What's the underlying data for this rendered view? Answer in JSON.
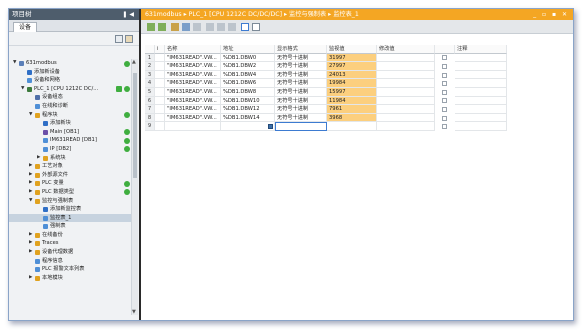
{
  "project_pane": {
    "title": "项目树",
    "controls": "❚◀",
    "tab": "设备",
    "tree": [
      {
        "label": "631modbus",
        "depth": 0,
        "expand": "▼",
        "icon": "#5a7fb8",
        "status": "ok"
      },
      {
        "label": "添加新设备",
        "depth": 1,
        "expand": "",
        "icon": "#2f6fc6"
      },
      {
        "label": "设备和网络",
        "depth": 1,
        "expand": "",
        "icon": "#4f8fd6"
      },
      {
        "label": "PLC_1 [CPU 1212C DC/...",
        "depth": 1,
        "expand": "▼",
        "icon": "#3c7a3c",
        "status": "ok2"
      },
      {
        "label": "设备组态",
        "depth": 2,
        "expand": "",
        "icon": "#4f6fa8"
      },
      {
        "label": "在线和诊断",
        "depth": 2,
        "expand": "",
        "icon": "#4f8fd6"
      },
      {
        "label": "程序块",
        "depth": 2,
        "expand": "▼",
        "icon": "#e0a21f",
        "status": "ok"
      },
      {
        "label": "添加新块",
        "depth": 3,
        "expand": "",
        "icon": "#2f6fc6"
      },
      {
        "label": "Main [OB1]",
        "depth": 3,
        "expand": "",
        "icon": "#6a4fa8",
        "status": "ok"
      },
      {
        "label": "IM631READ [DB1]",
        "depth": 3,
        "expand": "",
        "icon": "#4f8fd6",
        "status": "ok"
      },
      {
        "label": "IP [DB2]",
        "depth": 3,
        "expand": "",
        "icon": "#4f8fd6",
        "status": "ok"
      },
      {
        "label": "系统块",
        "depth": 3,
        "expand": "▶",
        "icon": "#e0a21f"
      },
      {
        "label": "工艺对象",
        "depth": 2,
        "expand": "▶",
        "icon": "#e0a21f"
      },
      {
        "label": "外部源文件",
        "depth": 2,
        "expand": "▶",
        "icon": "#e0a21f"
      },
      {
        "label": "PLC 变量",
        "depth": 2,
        "expand": "▶",
        "icon": "#e0a21f",
        "status": "ok"
      },
      {
        "label": "PLC 数据类型",
        "depth": 2,
        "expand": "▶",
        "icon": "#e0a21f",
        "status": "ok"
      },
      {
        "label": "监控与强制表",
        "depth": 2,
        "expand": "▼",
        "icon": "#e0a21f"
      },
      {
        "label": "添加新监控表",
        "depth": 3,
        "expand": "",
        "icon": "#2f6fc6"
      },
      {
        "label": "监控表_1",
        "depth": 3,
        "expand": "",
        "icon": "#4f8fd6",
        "selected": true
      },
      {
        "label": "强制表",
        "depth": 3,
        "expand": "",
        "icon": "#4f8fd6"
      },
      {
        "label": "在线备份",
        "depth": 2,
        "expand": "▶",
        "icon": "#e0a21f"
      },
      {
        "label": "Traces",
        "depth": 2,
        "expand": "▶",
        "icon": "#e0a21f"
      },
      {
        "label": "设备代理数据",
        "depth": 2,
        "expand": "▶",
        "icon": "#e0a21f"
      },
      {
        "label": "程序信息",
        "depth": 2,
        "expand": "",
        "icon": "#4f8fd6"
      },
      {
        "label": "PLC 报警文本列表",
        "depth": 2,
        "expand": "",
        "icon": "#4f8fd6"
      },
      {
        "label": "本地模块",
        "depth": 2,
        "expand": "▶",
        "icon": "#e0a21f"
      }
    ]
  },
  "editor": {
    "breadcrumb": "631modbus ▸ PLC_1 [CPU 1212C DC/DC/DC] ▸ 监控与强制表 ▸ 监控表_1",
    "controls": "_ ▫ ▪ ✕",
    "columns": [
      "i",
      "名称",
      "地址",
      "显示格式",
      "监视值",
      "修改值",
      "",
      "注释"
    ],
    "rows": [
      {
        "n": "1",
        "name": "\"IM631READ\".VW...",
        "addr": "%DB1.DBW0",
        "fmt": "无符号十进制",
        "val": "31997"
      },
      {
        "n": "2",
        "name": "\"IM631READ\".VW...",
        "addr": "%DB1.DBW2",
        "fmt": "无符号十进制",
        "val": "27997"
      },
      {
        "n": "3",
        "name": "\"IM631READ\".VW...",
        "addr": "%DB1.DBW4",
        "fmt": "无符号十进制",
        "val": "24013"
      },
      {
        "n": "4",
        "name": "\"IM631READ\".VW...",
        "addr": "%DB1.DBW6",
        "fmt": "无符号十进制",
        "val": "19984"
      },
      {
        "n": "5",
        "name": "\"IM631READ\".VW...",
        "addr": "%DB1.DBW8",
        "fmt": "无符号十进制",
        "val": "15997"
      },
      {
        "n": "6",
        "name": "\"IM631READ\".VW...",
        "addr": "%DB1.DBW10",
        "fmt": "无符号十进制",
        "val": "11984"
      },
      {
        "n": "7",
        "name": "\"IM631READ\".VW...",
        "addr": "%DB1.DBW12",
        "fmt": "无符号十进制",
        "val": "7961"
      },
      {
        "n": "8",
        "name": "\"IM631READ\".VW...",
        "addr": "%DB1.DBW14",
        "fmt": "无符号十进制",
        "val": "3968"
      },
      {
        "n": "9",
        "name": "",
        "addr": "",
        "fmt": "",
        "val": ""
      }
    ]
  },
  "colors": {
    "accent": "#f4a623",
    "monitor_value": "#fccf7e",
    "status_ok": "#3fae3f"
  }
}
